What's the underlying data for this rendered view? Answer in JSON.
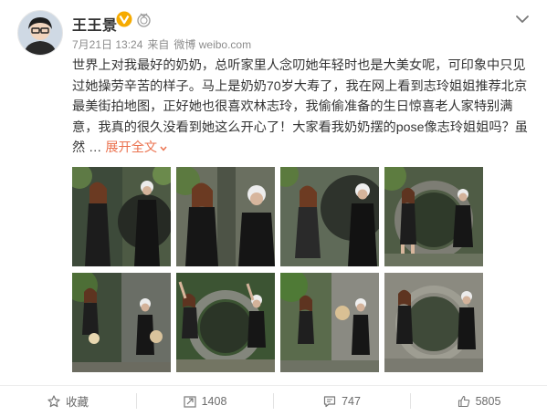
{
  "user": {
    "name": "王王景",
    "timestamp": "7月21日 13:24",
    "via_label": "来自",
    "source": "微博 weibo.com"
  },
  "post": {
    "text": "世界上对我最好的奶奶，总听家里人念叨她年轻时也是大美女呢，可印象中只见过她操劳辛苦的样子。马上是奶奶70岁大寿了，我在网上看到志玲姐姐推荐北京最美街拍地图，正好她也很喜欢林志玲，我偷偷准备的生日惊喜老人家特别满意，我真的很久没看到她这么开心了！大家看我奶奶摆的pose像志玲姐姐吗？虽然 …",
    "expand_label": "展开全文",
    "expand_icon": "chevron-down-icon"
  },
  "colors": {
    "accent": "#eb7350",
    "verified_badge": "#f6ab00",
    "text": "#333333",
    "meta": "#8c8c8c"
  },
  "actions": {
    "favorite": {
      "label": "收藏",
      "icon": "star-icon"
    },
    "repost": {
      "label": "1408",
      "icon": "repost-icon"
    },
    "comment": {
      "label": "747",
      "icon": "comment-icon"
    },
    "like": {
      "label": "5805",
      "icon": "thumbs-up-icon"
    }
  }
}
